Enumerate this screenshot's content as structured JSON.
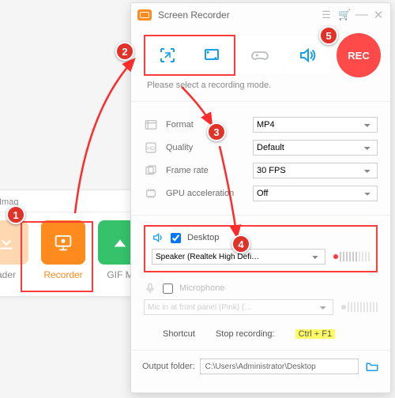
{
  "bg": {
    "tab_image": "Imag",
    "items": [
      {
        "label": "ader"
      },
      {
        "label": "Recorder"
      },
      {
        "label": "GIF M"
      }
    ]
  },
  "window": {
    "title": "Screen Recorder",
    "hint": "Please select a recording mode.",
    "rec_label": "REC",
    "rows": {
      "format": {
        "label": "Format",
        "value": "MP4"
      },
      "quality": {
        "label": "Quality",
        "value": "Default"
      },
      "framerate": {
        "label": "Frame rate",
        "value": "30 FPS"
      },
      "gpu": {
        "label": "GPU acceleration",
        "value": "Off"
      }
    },
    "audio": {
      "desktop": {
        "label": "Desktop",
        "device": "Speaker (Realtek High Defi…",
        "checked": true
      },
      "mic": {
        "label": "Microphone",
        "device": "Mic in at front panel (Pink) (…",
        "checked": false
      }
    },
    "shortcuts": {
      "label": "Shortcut",
      "stop_label": "Stop recording:",
      "stop_key": "Ctrl + F1"
    },
    "output": {
      "label": "Output folder:",
      "path": "C:\\Users\\Administrator\\Desktop"
    }
  },
  "callouts": [
    "1",
    "2",
    "3",
    "4",
    "5"
  ]
}
